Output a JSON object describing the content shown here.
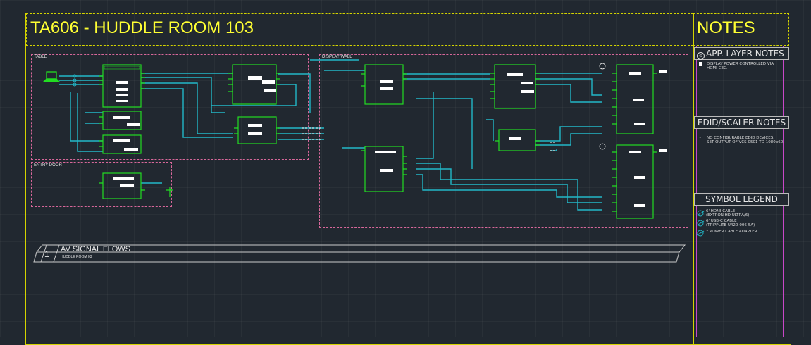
{
  "title_block": {
    "title": "TA606 - HUDDLE ROOM 103"
  },
  "notes_block": {
    "title": "NOTES"
  },
  "zones": {
    "table": "TABLE",
    "entry_door": "ENTRY DOOR",
    "display_wall": "DISPLAY WALL"
  },
  "sections": {
    "app_layer": {
      "heading": "APP. LAYER NOTES",
      "items": [
        "DISPLAY POWER CONTROLLED VIA",
        "HDMI-CEC."
      ]
    },
    "edid": {
      "heading": "EDID/SCALER  NOTES",
      "items": [
        "NO CONFIGURABLE EDID DEVICES.",
        "SET OUTPUT OF VCS-0501 TO 1080p60."
      ]
    },
    "legend": {
      "heading": "SYMBOL LEGEND",
      "items": [
        {
          "symbol": "A",
          "lines": [
            "6' HDMI CABLE",
            "(EXTRON HD ULTRA/6)"
          ]
        },
        {
          "symbol": "B",
          "lines": [
            "6' USB-C CABLE",
            "(TRIPPLITE U420-006-5A)"
          ]
        },
        {
          "symbol": "C",
          "lines": [
            "Y POWER CABLE ADAPTER"
          ]
        }
      ]
    }
  },
  "drawing": {
    "number": "1",
    "title": "AV SIGNAL FLOWS",
    "subtitle": "HUDDLE ROOM 03"
  },
  "colors": {
    "background": "#212830",
    "title_yellow": "#ffff33",
    "frame_yellow": "#d4d400",
    "zone_pink": "#d8679a",
    "device_green": "#22dd22",
    "signal_cyan": "#22b8c8",
    "notes_magenta": "#c847c8"
  }
}
